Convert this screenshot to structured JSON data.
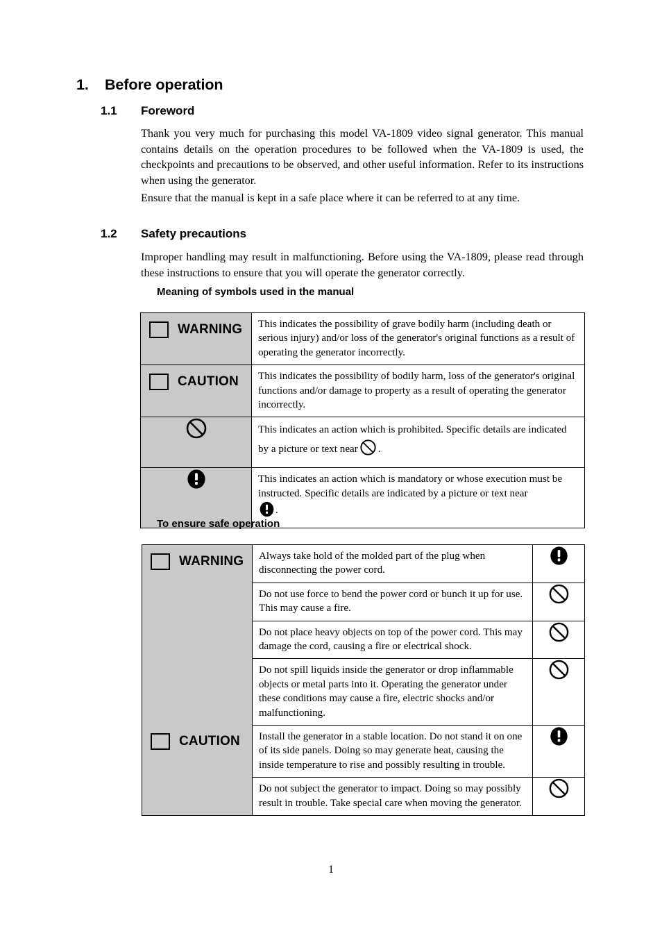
{
  "document": {
    "page_number": "1"
  },
  "section": {
    "number": "1.",
    "title": "Before operation"
  },
  "foreword": {
    "number": "1.1",
    "title": "Foreword",
    "paragraph_1": "Thank you very much for purchasing this model VA-1809 video signal generator.    This manual contains details on the operation procedures to be followed when the VA-1809 is used, the checkpoints and precautions to be observed, and other useful information. Refer to its instructions when using the generator.",
    "paragraph_2": "Ensure that the manual is kept in a safe place where it can be referred to at any time."
  },
  "safety": {
    "number": "1.2",
    "title": "Safety precautions",
    "intro": "Improper handling may result in malfunctioning.    Before using the VA-1809, please read through these instructions to ensure that you will operate the generator correctly.",
    "symbols_heading": "Meaning of symbols used in the manual",
    "safe_operation_heading": "To ensure safe operation"
  },
  "symbols_table": {
    "rows": [
      {
        "label": "WARNING",
        "icon": "square-icon",
        "description": "This indicates the possibility of grave bodily harm (including death or serious injury) and/or loss of the generator's original functions as a result of operating the generator incorrectly."
      },
      {
        "label": "CAUTION",
        "icon": "square-icon",
        "description": "This indicates the possibility of bodily harm, loss of the generator's original functions and/or damage to property as a result of operating the generator incorrectly."
      },
      {
        "label": "",
        "icon": "prohibition-icon",
        "description_part_1": "This indicates an action which is prohibited.    Specific details are indicated by a picture or text near",
        "description_part_2": "."
      },
      {
        "label": "",
        "icon": "mandatory-icon",
        "description_part_1": "This indicates an action which is mandatory or whose execution must be instructed.    Specific details are indicated by a picture or text near",
        "description_part_2": "."
      }
    ]
  },
  "safe_operation_table": {
    "groups": [
      {
        "label": "WARNING",
        "label_icon": "square-icon",
        "rows": [
          {
            "text": "Always take hold of the molded part of the plug when disconnecting the power cord.",
            "icon": "mandatory-icon"
          },
          {
            "text": "Do not use force to bend the power cord or bunch it up for use.    This may cause a fire.",
            "icon": "prohibition-icon"
          },
          {
            "text": "Do not place heavy objects on top of the power cord.    This may damage the cord, causing a fire or electrical shock.",
            "icon": "prohibition-icon"
          },
          {
            "text": "Do not spill liquids inside the generator or drop inflammable objects or metal parts into it.    Operating the generator under these conditions may cause a fire, electric shocks and/or malfunctioning.",
            "icon": "prohibition-icon"
          }
        ]
      },
      {
        "label": "CAUTION",
        "label_icon": "square-icon",
        "rows": [
          {
            "text": "Install the generator in a stable location.    Do not stand it on one of its side panels.    Doing so may generate heat, causing the inside temperature to rise and possibly resulting in trouble.",
            "icon": "mandatory-icon"
          },
          {
            "text": "Do not subject the generator to impact.    Doing so may possibly result in trouble.    Take special care when moving the generator.",
            "icon": "prohibition-icon"
          }
        ]
      }
    ]
  },
  "colors": {
    "label_background": "#c9c9c9",
    "border": "#000000",
    "text": "#000000",
    "page_background": "#ffffff"
  }
}
